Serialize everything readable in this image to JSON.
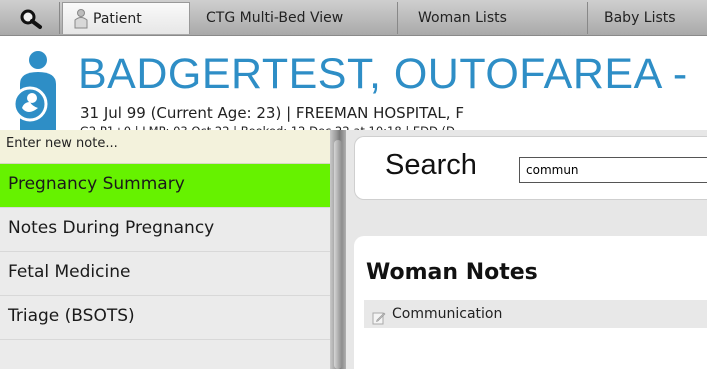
{
  "tabs": [
    {
      "label": "Patient"
    },
    {
      "label": "CTG Multi-Bed View"
    },
    {
      "label": "Woman Lists"
    },
    {
      "label": "Baby Lists"
    }
  ],
  "patient": {
    "name": "BADGERTEST, OUTOFAREA -",
    "line1": "31 Jul 99 (Current Age: 23) | FREEMAN HOSPITAL, F",
    "line2": "G2 P1+0 | LMP: 03 Oct 22 | Booked: 12 Dec 22 at 10:18 | EDD (D"
  },
  "nav": {
    "new_note": "Enter new note...",
    "items": [
      {
        "label": "Pregnancy Summary"
      },
      {
        "label": "Notes During Pregnancy"
      },
      {
        "label": "Fetal Medicine"
      },
      {
        "label": "Triage (BSOTS)"
      }
    ]
  },
  "search": {
    "label": "Search",
    "value": "commun"
  },
  "notes": {
    "title": "Woman Notes",
    "items": [
      {
        "label": "Communication"
      }
    ]
  },
  "colors": {
    "accent": "#2e8ec6",
    "active_nav": "#66f200",
    "new_note_bg": "#f3f2dc"
  }
}
